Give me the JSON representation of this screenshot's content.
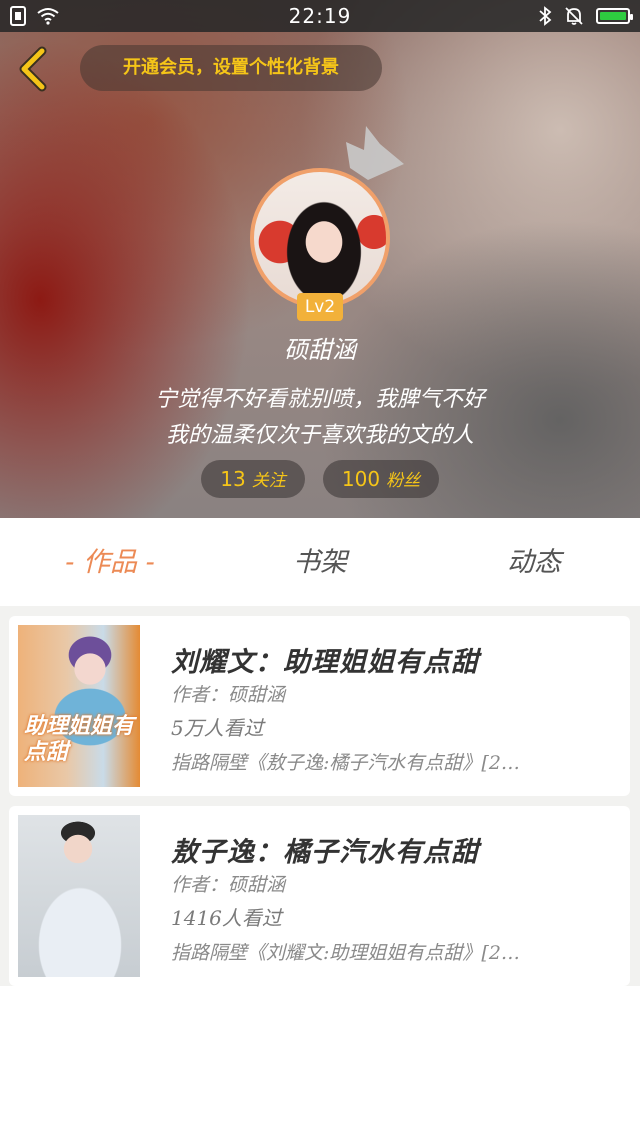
{
  "status_bar": {
    "time": "22:19",
    "battery_color": "#2ecc40"
  },
  "header": {
    "back_icon": "chevron-left-icon",
    "vip_banner": "开通会员，设置个性化背景",
    "level": "Lv2",
    "username": "硕甜涵",
    "bio_line1": "宁觉得不好看就别喷，我脾气不好",
    "bio_line2": "我的温柔仅次于喜欢我的文的人",
    "following": {
      "count": "13",
      "label": "关注"
    },
    "fans": {
      "count": "100",
      "label": "粉丝"
    }
  },
  "tabs": [
    {
      "label": "- 作品 -",
      "active": true
    },
    {
      "label": "书架",
      "active": false
    },
    {
      "label": "动态",
      "active": false
    }
  ],
  "books": [
    {
      "title": "刘耀文：助理姐姐有点甜",
      "author": "作者：硕甜涵",
      "views": "5万人看过",
      "latest": "指路隔壁《敖子逸:橘子汽水有点甜》[2…",
      "cover_text": "助理姐姐有点甜"
    },
    {
      "title": "敖子逸：橘子汽水有点甜",
      "author": "作者：硕甜涵",
      "views": "1416人看过",
      "latest": "指路隔壁《刘耀文:助理姐姐有点甜》[2…"
    }
  ],
  "colors": {
    "accent": "#ec8a55",
    "gold": "#f5c518",
    "level_badge": "#f2b13a"
  }
}
